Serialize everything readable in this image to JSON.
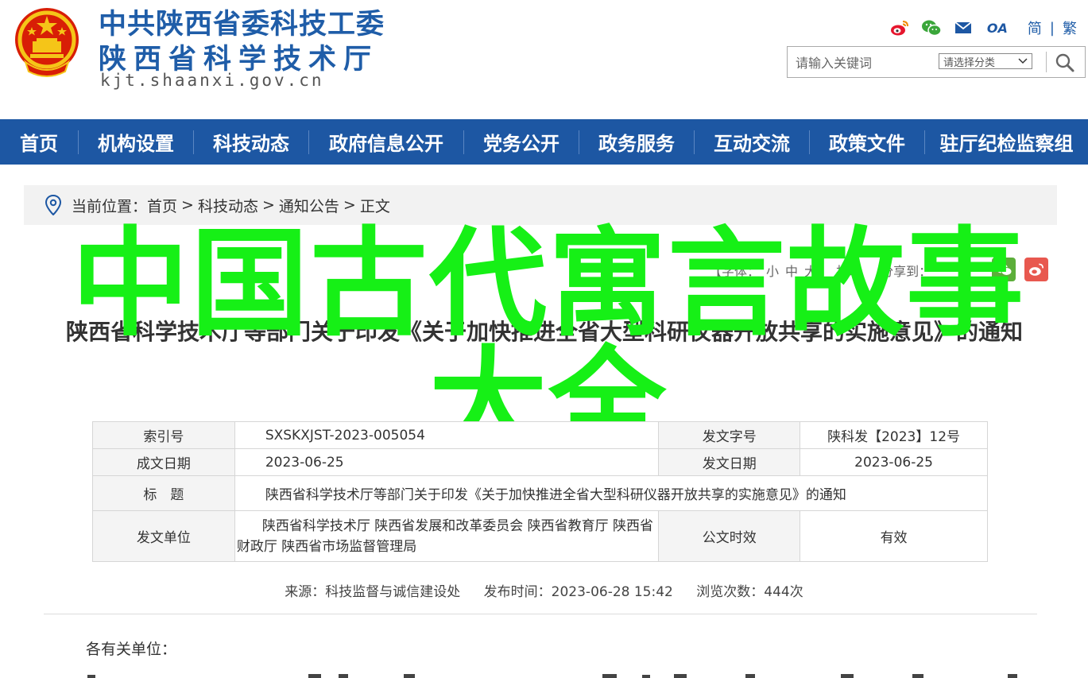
{
  "header": {
    "org_line1": "中共陕西省委科技工委",
    "org_line2": "陕西省科学技术厅",
    "url": "kjt.shaanxi.gov.cn",
    "icons": [
      "weibo-icon",
      "wechat-icon",
      "mail-icon",
      "oa-icon"
    ],
    "oa_label": "OA",
    "lang_simplified": "简",
    "lang_separator": "|",
    "lang_traditional": "繁",
    "search": {
      "placeholder": "请输入关键词",
      "category_select": "请选择分类"
    }
  },
  "nav": {
    "items": [
      "首页",
      "机构设置",
      "科技动态",
      "政府信息公开",
      "党务公开",
      "政务服务",
      "互动交流",
      "政策文件",
      "驻厅纪检监察组"
    ]
  },
  "breadcrumb": {
    "prefix": "当前位置：",
    "items": [
      "首页",
      "科技动态",
      "通知公告",
      "正文"
    ],
    "separator": ">"
  },
  "tools": {
    "font_label": "【字体：",
    "sizes": [
      "小",
      "中",
      "大"
    ],
    "font_close": "】",
    "print": "打印",
    "share": "分享到："
  },
  "article": {
    "title": "陕西省科学技术厅等部门关于印发《关于加快推进全省大型科研仪器开放共享的实施意见》的通知"
  },
  "overlay": {
    "line1": "中国古代寓言故事",
    "line2": "大全"
  },
  "info_table": {
    "index_label": "索引号",
    "index_value": "SXSKXJST-2023-005054",
    "docno_label": "发文字号",
    "docno_value": "陕科发【2023】12号",
    "created_label": "成文日期",
    "created_value": "2023-06-25",
    "issued_label": "发文日期",
    "issued_value": "2023-06-25",
    "title_label": "标　题",
    "title_value": "陕西省科学技术厅等部门关于印发《关于加快推进全省大型科研仪器开放共享的实施意见》的通知",
    "unit_label": "发文单位",
    "unit_value": "陕西省科学技术厅 陕西省发展和改革委员会 陕西省教育厅 陕西省财政厅 陕西省市场监督管理局",
    "validity_label": "公文时效",
    "validity_value": "有效"
  },
  "meta": {
    "source": "来源：科技监督与诚信建设处",
    "published": "发布时间：2023-06-28 15:42",
    "views": "浏览次数：444次"
  },
  "body": {
    "salutation": "各有关单位："
  },
  "colors": {
    "brand_blue": "#1d57a3",
    "overlay_green": "#16f016",
    "weibo_red": "#e6162d",
    "wechat_green": "#3aa63a"
  }
}
